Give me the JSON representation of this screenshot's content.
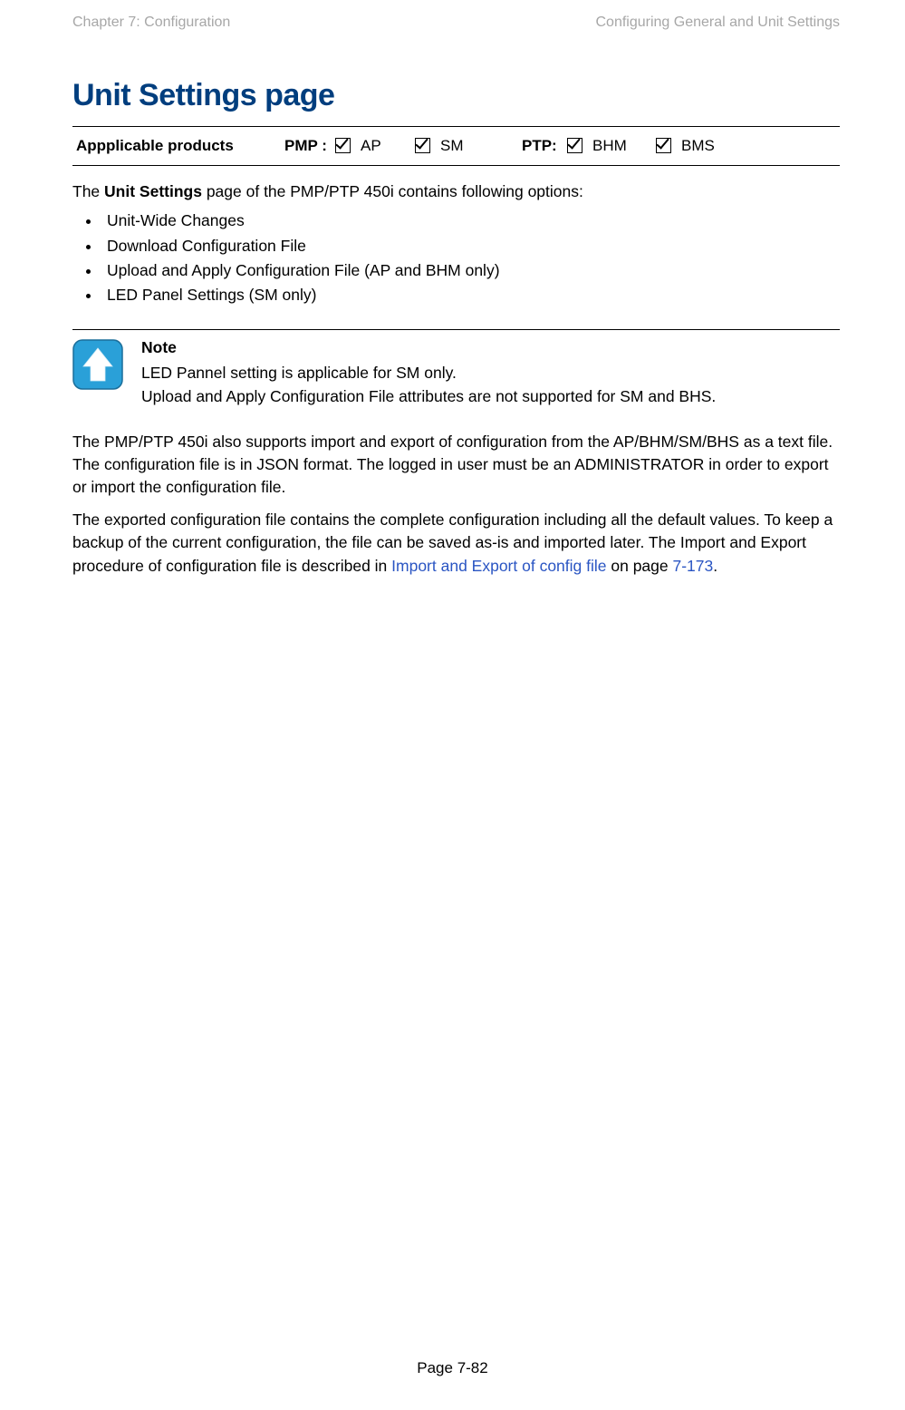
{
  "header": {
    "left": "Chapter 7:  Configuration",
    "right": "Configuring General and Unit Settings"
  },
  "title": "Unit Settings page",
  "applicable": {
    "label": "Appplicable products",
    "pmp_label": "PMP :",
    "ap": "AP",
    "sm": "SM",
    "ptp_label": "PTP:",
    "bhm": "BHM",
    "bms": "BMS"
  },
  "intro": {
    "prefix": "The ",
    "bold": "Unit Settings",
    "suffix": " page of the PMP/PTP 450i contains following options:"
  },
  "bullets": [
    "Unit-Wide Changes",
    "Download Configuration File",
    "Upload and Apply Configuration File (AP and BHM only)",
    "LED Panel Settings (SM only)"
  ],
  "note": {
    "title": "Note",
    "line1": "LED Pannel setting is applicable for SM only.",
    "line2": "Upload and Apply Configuration File attributes are not supported for SM and BHS."
  },
  "para1": "The PMP/PTP 450i also supports import and export of configuration from the AP/BHM/SM/BHS as a text file. The configuration file is in JSON format. The logged in user must be an ADMINISTRATOR in order to export or import the configuration file.",
  "para2": {
    "t1": "The exported configuration file contains the complete configuration including all the default values. To keep a backup of the current configuration, the file can be saved as-is and imported later. The Import and Export procedure of configuration file is described in ",
    "link1": "Import and Export of config file",
    "t2": " on page ",
    "link2": "7-173",
    "t3": "."
  },
  "footer": "Page 7-82"
}
